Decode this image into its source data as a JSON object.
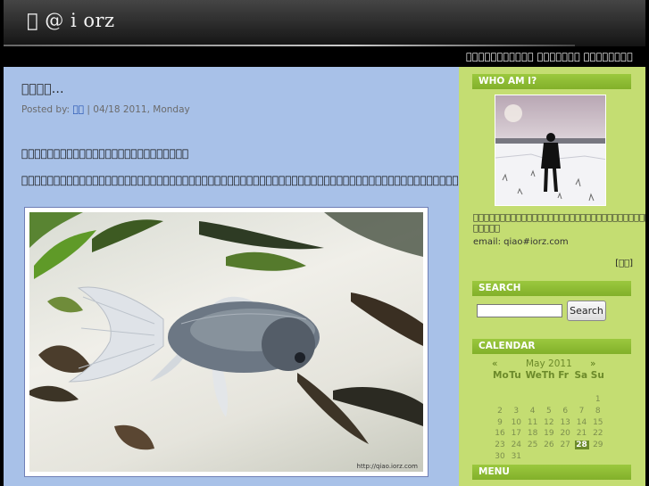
{
  "header": {
    "title": "\u0000 @ i orz",
    "tagline": "\u0000\u0000\u0000\u0000\u0000\u0000\u0000\u0000\u0000\u0000\u0000 \u0000\u0000\u0000\u0000\u0000\u0000\u0000 \u0000\u0000\u0000\u0000\u0000\u0000\u0000\u0000"
  },
  "post": {
    "title": "\u0000\u0000\u0000\u0000…",
    "posted_by_label": "Posted by:",
    "author": "\u0000\u0000",
    "date": "| 04/18 2011, Monday",
    "paragraph_1": "\u0000\u0000\u0000\u0000\u0000\u0000\u0000\u0000\u0000\u0000\u0000\u0000\u0000\u0000\u0000\u0000\u0000\u0000\u0000\u0000\u0000\u0000\u0000\u0000\u0000\u0000",
    "paragraph_2": "\u0000\u0000\u0000\u0000\u0000\u0000\u0000\u0000\u0000\u0000\u0000\u0000\u0000\u0000\u0000\u0000\u0000\u0000\u0000\u0000\u0000\u0000\u0000\u0000\u0000\u0000\u0000\u0000\u0000\u0000\u0000\u0000\u0000\u0000\u0000\u0000\u0000\u0000\u0000\u0000\u0000\u0000\u0000\u0000\u0000\u0000\u0000\u0000\u0000\u0000\u0000\u0000\u0000\u0000\u0000\u0000\u0000\u0000\u0000\u0000\u0000\u0000\u0000\u0000\u0000\u0000\u0000\u0000\u0000\u0000\u0000\u0000\u0000\u0000\u0000\u0000\u0000\u0000\u0000",
    "photo_watermark": "http://qiao.iorz.com"
  },
  "sidebar": {
    "who_header": "WHO AM I?",
    "bio": "\u0000\u0000\u0000\u0000\u0000\u0000\u0000\u0000\u0000\u0000\u0000\u0000\u0000\u0000\u0000\u0000\u0000\u0000\u0000\u0000\u0000\u0000\u0000\u0000\u0000\u0000\u0000\u0000\u0000\u0000\u0000\u0000\u0000\u0000\u0000\u0000\u0000\u0000\u0000\u0000\u0000\u0000\u0000… \u0000\u0000\u0000\u0000\u0000",
    "email": "email: qiao#iorz.com",
    "more_link": "[\u0000\u0000]",
    "search_header": "SEARCH",
    "search_value": "",
    "search_button": "Search",
    "calendar_header": "CALENDAR",
    "menu_header": "MENU"
  },
  "calendar": {
    "prev": "«",
    "month": "May 2011",
    "next": "»",
    "weekdays": [
      "Mo",
      "Tu",
      "We",
      "Th",
      "Fr",
      "Sa",
      "Su"
    ],
    "weeks": [
      [
        "",
        "",
        "",
        "",
        "",
        "",
        "1"
      ],
      [
        "2",
        "3",
        "4",
        "5",
        "6",
        "7",
        "8"
      ],
      [
        "9",
        "10",
        "11",
        "12",
        "13",
        "14",
        "15"
      ],
      [
        "16",
        "17",
        "18",
        "19",
        "20",
        "21",
        "22"
      ],
      [
        "23",
        "24",
        "25",
        "26",
        "27",
        "28",
        "29"
      ],
      [
        "30",
        "31",
        "",
        "",
        "",
        "",
        ""
      ]
    ],
    "today": "28"
  }
}
